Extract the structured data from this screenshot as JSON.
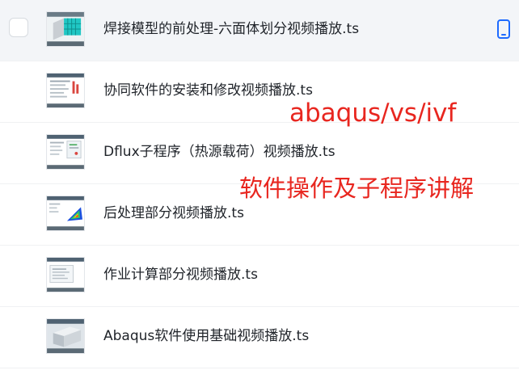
{
  "files": [
    {
      "title": "焊接模型的前处理-六面体划分视频播放.ts",
      "selected": true
    },
    {
      "title": "协同软件的安装和修改视频播放.ts"
    },
    {
      "title": "Dflux子程序（热源载荷）视频播放.ts"
    },
    {
      "title": "后处理部分视频播放.ts"
    },
    {
      "title": "作业计算部分视频播放.ts"
    },
    {
      "title": "Abaqus软件使用基础视频播放.ts"
    }
  ],
  "overlay": {
    "line1": "abaqus/vs/ivf",
    "line2": "软件操作及子程序讲解"
  },
  "colors": {
    "accent": "#1e6bff",
    "overlay_text": "#e8261f",
    "selected_row": "#f3f5f8"
  },
  "icons": {
    "row_1_trailing": "mobile-device-icon"
  }
}
